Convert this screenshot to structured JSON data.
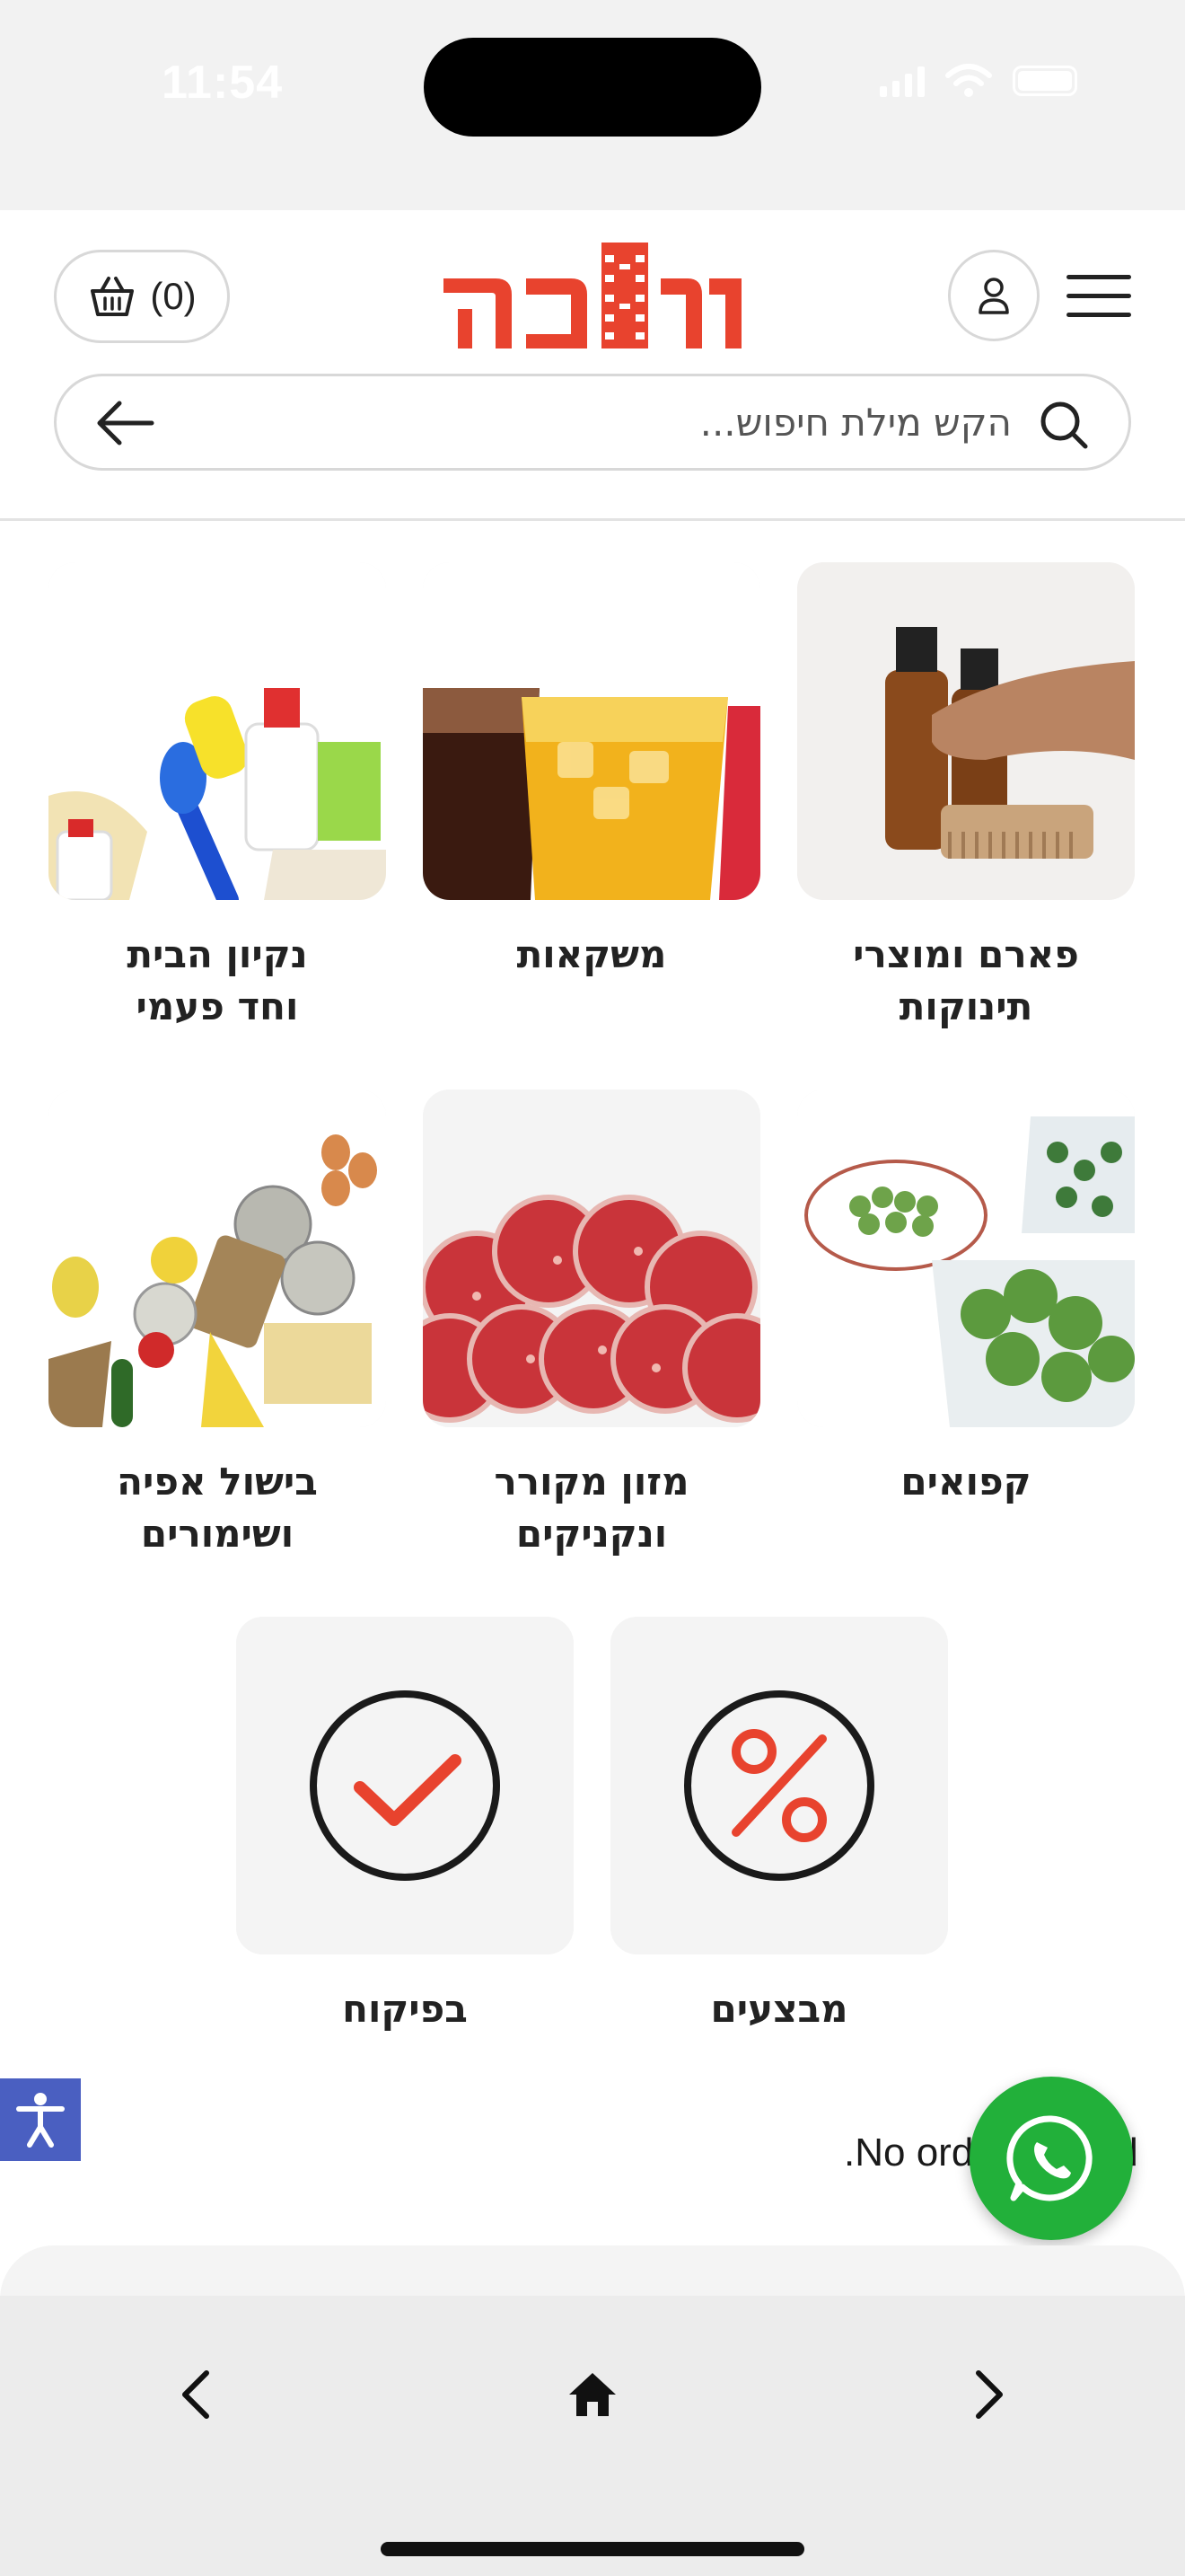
{
  "status_bar": {
    "time": "11:54"
  },
  "header": {
    "cart_label": "(0)",
    "logo_text": "המזווה",
    "icons": {
      "cart": "basket-icon",
      "user": "user-icon",
      "menu": "hamburger-icon",
      "back": "arrow-left-icon",
      "search": "search-icon"
    }
  },
  "search": {
    "placeholder": "הקש מילת חיפוש..."
  },
  "categories": [
    {
      "label": "פארם ומוצרי\nתינוקות"
    },
    {
      "label": "משקאות"
    },
    {
      "label": "נקיון הבית\nוחד פעמי"
    },
    {
      "label": "קפואים"
    },
    {
      "label": "מזון מקורר\nונקניקים"
    },
    {
      "label": "בישול אפיה\nושימורים"
    },
    {
      "label": "מבצעים"
    },
    {
      "label": "בפיקוח"
    }
  ],
  "orders": {
    "message": ".No orders found"
  },
  "bottom_nav": {
    "icons": [
      "chevron-left-icon",
      "home-icon",
      "chevron-right-icon"
    ]
  },
  "colors": {
    "brand_red": "#e8432e",
    "whatsapp_green": "#22b03a",
    "a11y_blue": "#4a5fc1"
  }
}
